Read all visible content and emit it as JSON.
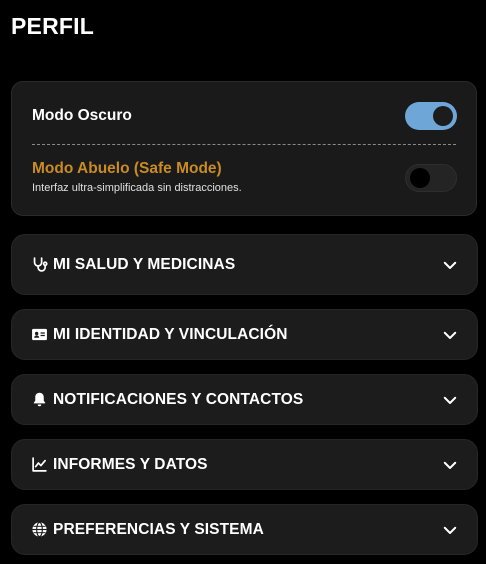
{
  "page": {
    "title": "PERFIL"
  },
  "settings": {
    "dark_mode": {
      "label": "Modo Oscuro",
      "enabled": true
    },
    "grandpa_mode": {
      "label": "Modo Abuelo (Safe Mode)",
      "description": "Interfaz ultra-simplificada sin distracciones.",
      "enabled": false
    }
  },
  "sections": [
    {
      "label": "MI SALUD Y MEDICINAS",
      "icon": "stethoscope-icon"
    },
    {
      "label": "MI IDENTIDAD Y VINCULACIÓN",
      "icon": "id-card-icon"
    },
    {
      "label": "NOTIFICACIONES Y CONTACTOS",
      "icon": "bell-icon"
    },
    {
      "label": "INFORMES Y DATOS",
      "icon": "chart-line-icon"
    },
    {
      "label": "PREFERENCIAS Y SISTEMA",
      "icon": "globe-icon"
    }
  ],
  "colors": {
    "background": "#000000",
    "card": "#1c1c1c",
    "toggle_on": "#6fa6d8",
    "accent_orange": "#c98b23"
  }
}
